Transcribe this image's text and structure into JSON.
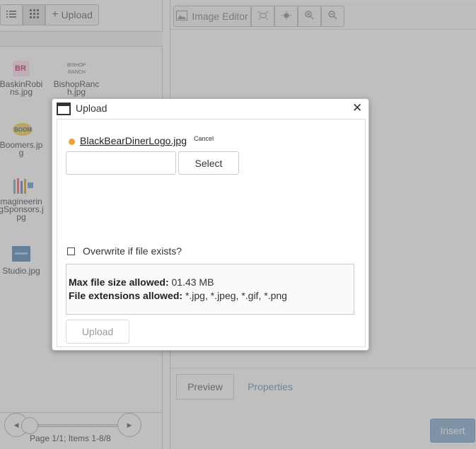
{
  "file_manager": {
    "upload_label": "Upload",
    "files": [
      {
        "name_line1": "BaskinRobi",
        "name_line2": "ns.jpg"
      },
      {
        "name_line1": "BishopRanc",
        "name_line2": "h.jpg"
      },
      {
        "name_line1": "Boomers.jp",
        "name_line2": "g"
      },
      {
        "name_line1": "magineerin",
        "name_line2": "gSponsors.j",
        "name_line3": "pg"
      },
      {
        "name_line1": "Studio.jpg"
      }
    ],
    "page_text": "Page 1/1; Items 1-8/8"
  },
  "image_editor": {
    "label": "Image Editor",
    "tabs": {
      "preview": "Preview",
      "properties": "Properties"
    },
    "insert_label": "Insert"
  },
  "upload_dialog": {
    "title": "Upload",
    "close_glyph": "✕",
    "file_name": "BlackBearDinerLogo.jpg",
    "cancel_label": "Cancel",
    "select_label": "Select",
    "overwrite_label": "Overwrite if file exists?",
    "overwrite_checked": false,
    "max_size_label": "Max file size allowed:",
    "max_size_value": "01.43 MB",
    "extensions_label": "File extensions allowed:",
    "extensions_value": "*.jpg, *.jpeg, *.gif, *.png",
    "upload_label": "Upload"
  },
  "colors": {
    "status_dot": "#f0a030",
    "insert_button": "#7ea6cc",
    "properties_tab": "#5a8cc0"
  },
  "icons": [
    "list-view-icon",
    "grid-view-icon",
    "plus-icon",
    "image-editor-icon",
    "fit-icon",
    "actual-size-icon",
    "zoom-in-icon",
    "zoom-out-icon",
    "window-icon",
    "close-icon",
    "prev-page-icon",
    "next-page-icon"
  ]
}
